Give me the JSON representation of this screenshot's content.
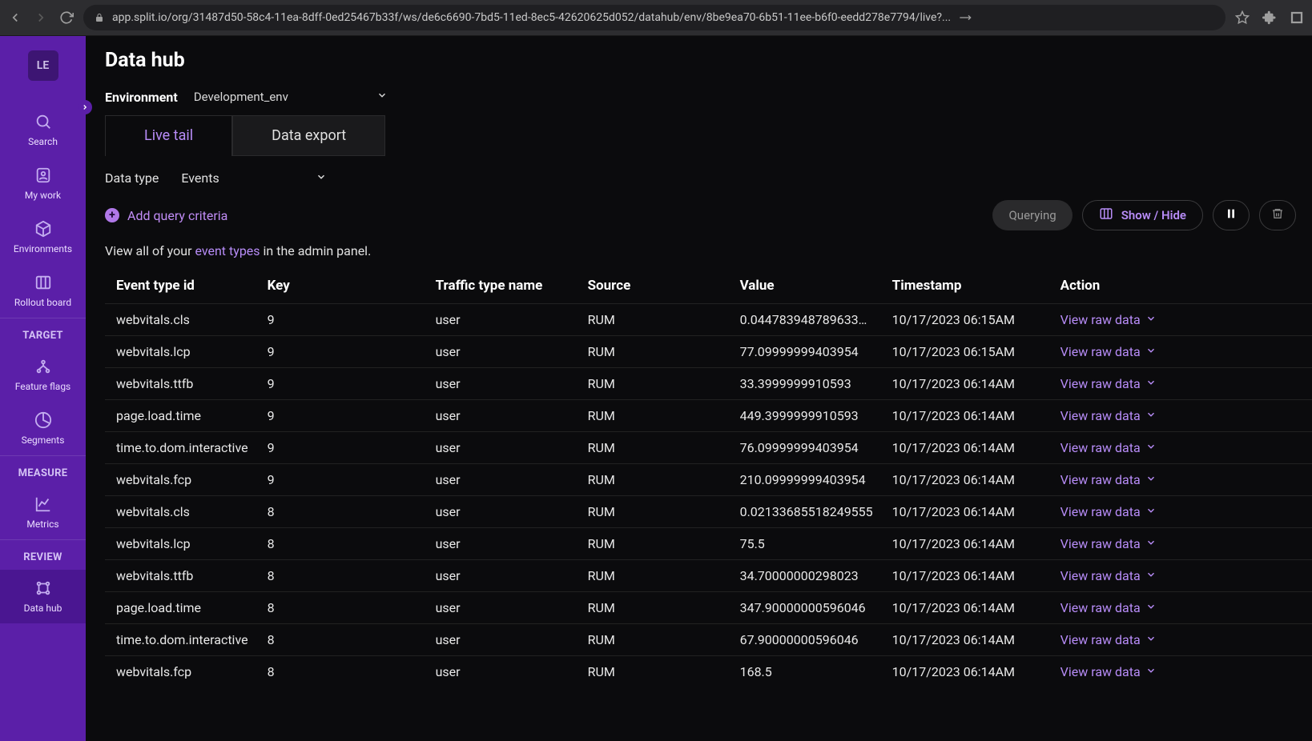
{
  "browser": {
    "url": "app.split.io/org/31487d50-58c4-11ea-8dff-0ed25467b33f/ws/de6c6690-7bd5-11ed-8ec5-42620625d052/datahub/env/8be9ea70-6b51-11ee-b6f0-eedd278e7794/live?..."
  },
  "sidebar": {
    "avatar": "LE",
    "nav": [
      {
        "label": "Search"
      },
      {
        "label": "My work"
      },
      {
        "label": "Environments"
      },
      {
        "label": "Rollout board"
      }
    ],
    "sections": [
      {
        "title": "TARGET",
        "items": [
          {
            "label": "Feature flags"
          },
          {
            "label": "Segments"
          }
        ]
      },
      {
        "title": "MEASURE",
        "items": [
          {
            "label": "Metrics"
          }
        ]
      },
      {
        "title": "REVIEW",
        "items": [
          {
            "label": "Data hub"
          }
        ]
      }
    ]
  },
  "page": {
    "title": "Data hub",
    "env_label": "Environment",
    "env_value": "Development_env",
    "tabs": [
      {
        "label": "Live tail"
      },
      {
        "label": "Data export"
      }
    ],
    "datatype_label": "Data type",
    "datatype_value": "Events",
    "add_query": "Add query criteria",
    "querying": "Querying",
    "showhide": "Show / Hide",
    "helper_pre": "View all of your ",
    "helper_link": "event types",
    "helper_post": " in the admin panel.",
    "columns": [
      "Event type id",
      "Key",
      "Traffic type name",
      "Source",
      "Value",
      "Timestamp",
      "Action"
    ],
    "action_label": "View raw data",
    "rows": [
      {
        "event": "webvitals.cls",
        "key": "9",
        "traffic": "user",
        "source": "RUM",
        "value": "0.044783948789633…",
        "ts": "10/17/2023 06:15AM"
      },
      {
        "event": "webvitals.lcp",
        "key": "9",
        "traffic": "user",
        "source": "RUM",
        "value": "77.09999999403954",
        "ts": "10/17/2023 06:15AM"
      },
      {
        "event": "webvitals.ttfb",
        "key": "9",
        "traffic": "user",
        "source": "RUM",
        "value": "33.3999999910593",
        "ts": "10/17/2023 06:14AM"
      },
      {
        "event": "page.load.time",
        "key": "9",
        "traffic": "user",
        "source": "RUM",
        "value": "449.3999999910593",
        "ts": "10/17/2023 06:14AM"
      },
      {
        "event": "time.to.dom.interactive",
        "key": "9",
        "traffic": "user",
        "source": "RUM",
        "value": "76.09999999403954",
        "ts": "10/17/2023 06:14AM"
      },
      {
        "event": "webvitals.fcp",
        "key": "9",
        "traffic": "user",
        "source": "RUM",
        "value": "210.09999999403954",
        "ts": "10/17/2023 06:14AM"
      },
      {
        "event": "webvitals.cls",
        "key": "8",
        "traffic": "user",
        "source": "RUM",
        "value": "0.02133685518249555",
        "ts": "10/17/2023 06:14AM"
      },
      {
        "event": "webvitals.lcp",
        "key": "8",
        "traffic": "user",
        "source": "RUM",
        "value": "75.5",
        "ts": "10/17/2023 06:14AM"
      },
      {
        "event": "webvitals.ttfb",
        "key": "8",
        "traffic": "user",
        "source": "RUM",
        "value": "34.70000000298023",
        "ts": "10/17/2023 06:14AM"
      },
      {
        "event": "page.load.time",
        "key": "8",
        "traffic": "user",
        "source": "RUM",
        "value": "347.90000000596046",
        "ts": "10/17/2023 06:14AM"
      },
      {
        "event": "time.to.dom.interactive",
        "key": "8",
        "traffic": "user",
        "source": "RUM",
        "value": "67.90000000596046",
        "ts": "10/17/2023 06:14AM"
      },
      {
        "event": "webvitals.fcp",
        "key": "8",
        "traffic": "user",
        "source": "RUM",
        "value": "168.5",
        "ts": "10/17/2023 06:14AM"
      }
    ]
  }
}
